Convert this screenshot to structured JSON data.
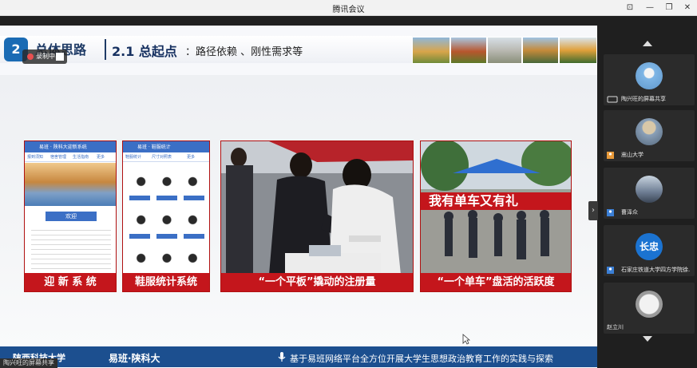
{
  "window": {
    "title": "腾讯会议"
  },
  "slide": {
    "header": {
      "prefix": "总体思路",
      "section": "2.1 总起点",
      "subtitle": "：路径依赖 、刚性需求等",
      "logo": "2"
    },
    "recording": {
      "label": "录制中"
    },
    "cards": [
      {
        "caption": "迎 新 系 统",
        "app_title": "易班 · 陕科大迎新系统",
        "tabs": [
          "报到须知",
          "宿舍管理",
          "生活指南",
          "更多"
        ],
        "intro": "欢迎"
      },
      {
        "caption": "鞋服统计系统",
        "app_title": "易班 · 鞋服统计",
        "tabs": [
          "鞋服统计",
          "尺寸对照表",
          "更多"
        ]
      },
      {
        "caption": "“一个平板”撬动的注册量"
      },
      {
        "caption": "“一个单车”盘活的活跃度",
        "banner": "我有单车又有礼"
      }
    ],
    "footer": {
      "school": "陕西科技大学",
      "brand": "易班·陕科大",
      "caption": "基于易班网络平台全方位开展大学生思想政治教育工作的实践与探索"
    }
  },
  "share_label": "陶兴旺的屏幕共享",
  "participants": [
    {
      "name": "陶兴旺的屏幕共享",
      "icon": "screen-share-icon",
      "avatar_color": "#6aa6d8"
    },
    {
      "name": "嵩山大学",
      "icon": "user-icon",
      "avatar_color": "#8aa0b8"
    },
    {
      "name": "曹泽众",
      "icon": "user-icon",
      "avatar_color": "#6f7f95"
    },
    {
      "name": "石家庄铁道大学四方学院徐...",
      "icon": "user-icon",
      "avatar_text": "长忠",
      "avatar_color": "#1b73d1"
    },
    {
      "name": "赵立川",
      "icon": "user-icon",
      "avatar_color": "#9a9a9a"
    }
  ],
  "colors": {
    "accent_red": "#c4161c",
    "footer_blue": "#1c4f8f",
    "brand_blue": "#1a6bb4"
  }
}
